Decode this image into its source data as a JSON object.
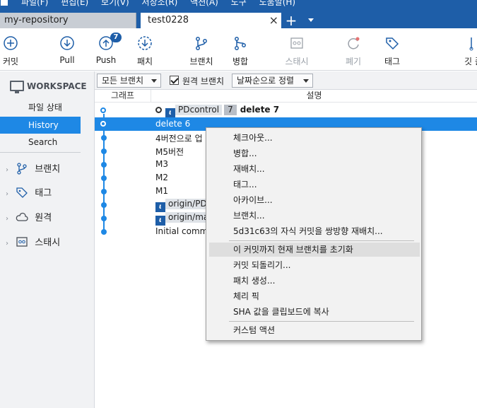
{
  "menubar": {
    "items": [
      "파일(F)",
      "편집(E)",
      "보기(V)",
      "저장소(R)",
      "액션(A)",
      "도구",
      "도움말(H)"
    ]
  },
  "tabs": {
    "repo": "my-repository",
    "active": "test0228",
    "close": "×",
    "add": "+"
  },
  "toolbar": {
    "commit": "커밋",
    "pull": "Pull",
    "push": "Push",
    "push_badge": "7",
    "fetch": "패치",
    "branch": "브랜치",
    "merge": "병합",
    "stash": "스태시",
    "discard": "폐기",
    "tag": "태그",
    "gitflow": "깃 플"
  },
  "sidebar": {
    "workspace": "WORKSPACE",
    "items": [
      "파일 상태",
      "History",
      "Search"
    ],
    "groups": [
      "브랜치",
      "태그",
      "원격",
      "스태시"
    ]
  },
  "filterbar": {
    "branches": "모든 브랜치",
    "remote_label": "원격 브랜치",
    "sort": "날짜순으로 정렬"
  },
  "columns": {
    "graph": "그래프",
    "description": "설명"
  },
  "commits": {
    "head": {
      "branch": "PDcontrol",
      "count": "7",
      "message": "delete 7"
    },
    "rows": [
      "delete 6",
      "4버전으로 업",
      "M5버전",
      "M3",
      "M2",
      "M1"
    ],
    "origin1": "origin/PDc",
    "origin2": "origin/ma",
    "initial": "Initial commi"
  },
  "context_menu": {
    "items": [
      "체크아웃...",
      "병합...",
      "재배치...",
      "태그...",
      "아카이브...",
      "브랜치...",
      "5d31c63의 자식 커밋을 쌍방향 재배치...",
      "이 커밋까지 현재 브랜치를 초기화",
      "커밋 되돌리기...",
      "패치 생성...",
      "체리 픽",
      "SHA 값을 클립보드에 복사",
      "커스텀 액션"
    ]
  },
  "colors": {
    "accent": "#1e88e5",
    "titlebar": "#1e5ea8",
    "selection": "#1e88e5"
  }
}
